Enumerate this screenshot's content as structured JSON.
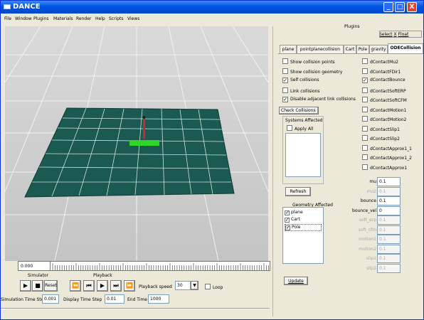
{
  "window": {
    "title": "DANCE",
    "min_glyph": "_",
    "max_glyph": "□",
    "close_glyph": "X"
  },
  "menu": [
    "File",
    "Window",
    "Plugins",
    "Materials",
    "Render",
    "Help",
    "Scripts",
    "Views"
  ],
  "timeline": {
    "current_time": "0.000"
  },
  "simulator": {
    "label": "Simulator",
    "reset_label": "Reset"
  },
  "playback": {
    "label": "Playback",
    "speed_label": "Playback speed",
    "speed_value": "30",
    "loop_label": "Loop"
  },
  "steps": {
    "sim_step_label": "Simulation Time Step",
    "sim_step_value": "0.001",
    "display_step_label": "Display Time Step",
    "display_step_value": "0.01",
    "end_time_label": "End Time",
    "end_time_value": "1000"
  },
  "plugins": {
    "header": "Plugins",
    "select_label": "Select",
    "x_label": "X",
    "float_label": "Float",
    "tabs": [
      "plane",
      "pointplanecollision",
      "Cart",
      "Pole",
      "gravity",
      "ODECollision"
    ],
    "checks": [
      {
        "label": "Show collision points",
        "checked": false
      },
      {
        "label": "Show collision geometry",
        "checked": false
      },
      {
        "label": "Self collisions",
        "checked": true
      },
      {
        "label": "Link collisions",
        "checked": false
      },
      {
        "label": "Disable adjacent link collisions",
        "checked": true
      }
    ],
    "check_collisions_label": "Check Collisions",
    "systems_affected_label": "Systems Affected",
    "apply_all_label": "Apply All",
    "refresh_label": "Refresh",
    "geometry_affected_label": "Geometry Affected",
    "geometry_items": [
      {
        "label": "plane",
        "checked": true
      },
      {
        "label": "Cart",
        "checked": true
      },
      {
        "label": "Pole",
        "checked": true
      }
    ],
    "update_label": "Update",
    "contacts": [
      {
        "label": "dContactMu2",
        "checked": false
      },
      {
        "label": "dContactFDir1",
        "checked": false
      },
      {
        "label": "dContactBounce",
        "checked": true
      },
      {
        "label": "dContactSoftERP",
        "checked": false
      },
      {
        "label": "dContactSoftCFM",
        "checked": false
      },
      {
        "label": "dContactMotion1",
        "checked": false
      },
      {
        "label": "dContactMotion2",
        "checked": false
      },
      {
        "label": "dContactSlip1",
        "checked": false
      },
      {
        "label": "dContactSlip2",
        "checked": false
      },
      {
        "label": "dContactApprox1_1",
        "checked": false
      },
      {
        "label": "dContactApprox1_2",
        "checked": false
      },
      {
        "label": "dContactApprox1",
        "checked": false
      }
    ],
    "params": [
      {
        "label": "mu",
        "value": "0.1",
        "enabled": true
      },
      {
        "label": "mu2",
        "value": "0.1",
        "enabled": false
      },
      {
        "label": "bounce",
        "value": "0.1",
        "enabled": true
      },
      {
        "label": "bounce_vel",
        "value": "0",
        "enabled": true
      },
      {
        "label": "soft_erp",
        "value": "0.1",
        "enabled": false
      },
      {
        "label": "soft_cfm",
        "value": "0.1",
        "enabled": false
      },
      {
        "label": "motion1",
        "value": "0.1",
        "enabled": false
      },
      {
        "label": "motion2",
        "value": "0.1",
        "enabled": false
      },
      {
        "label": "slip1",
        "value": "0.1",
        "enabled": false
      },
      {
        "label": "slip2",
        "value": "0.1",
        "enabled": false
      }
    ]
  }
}
